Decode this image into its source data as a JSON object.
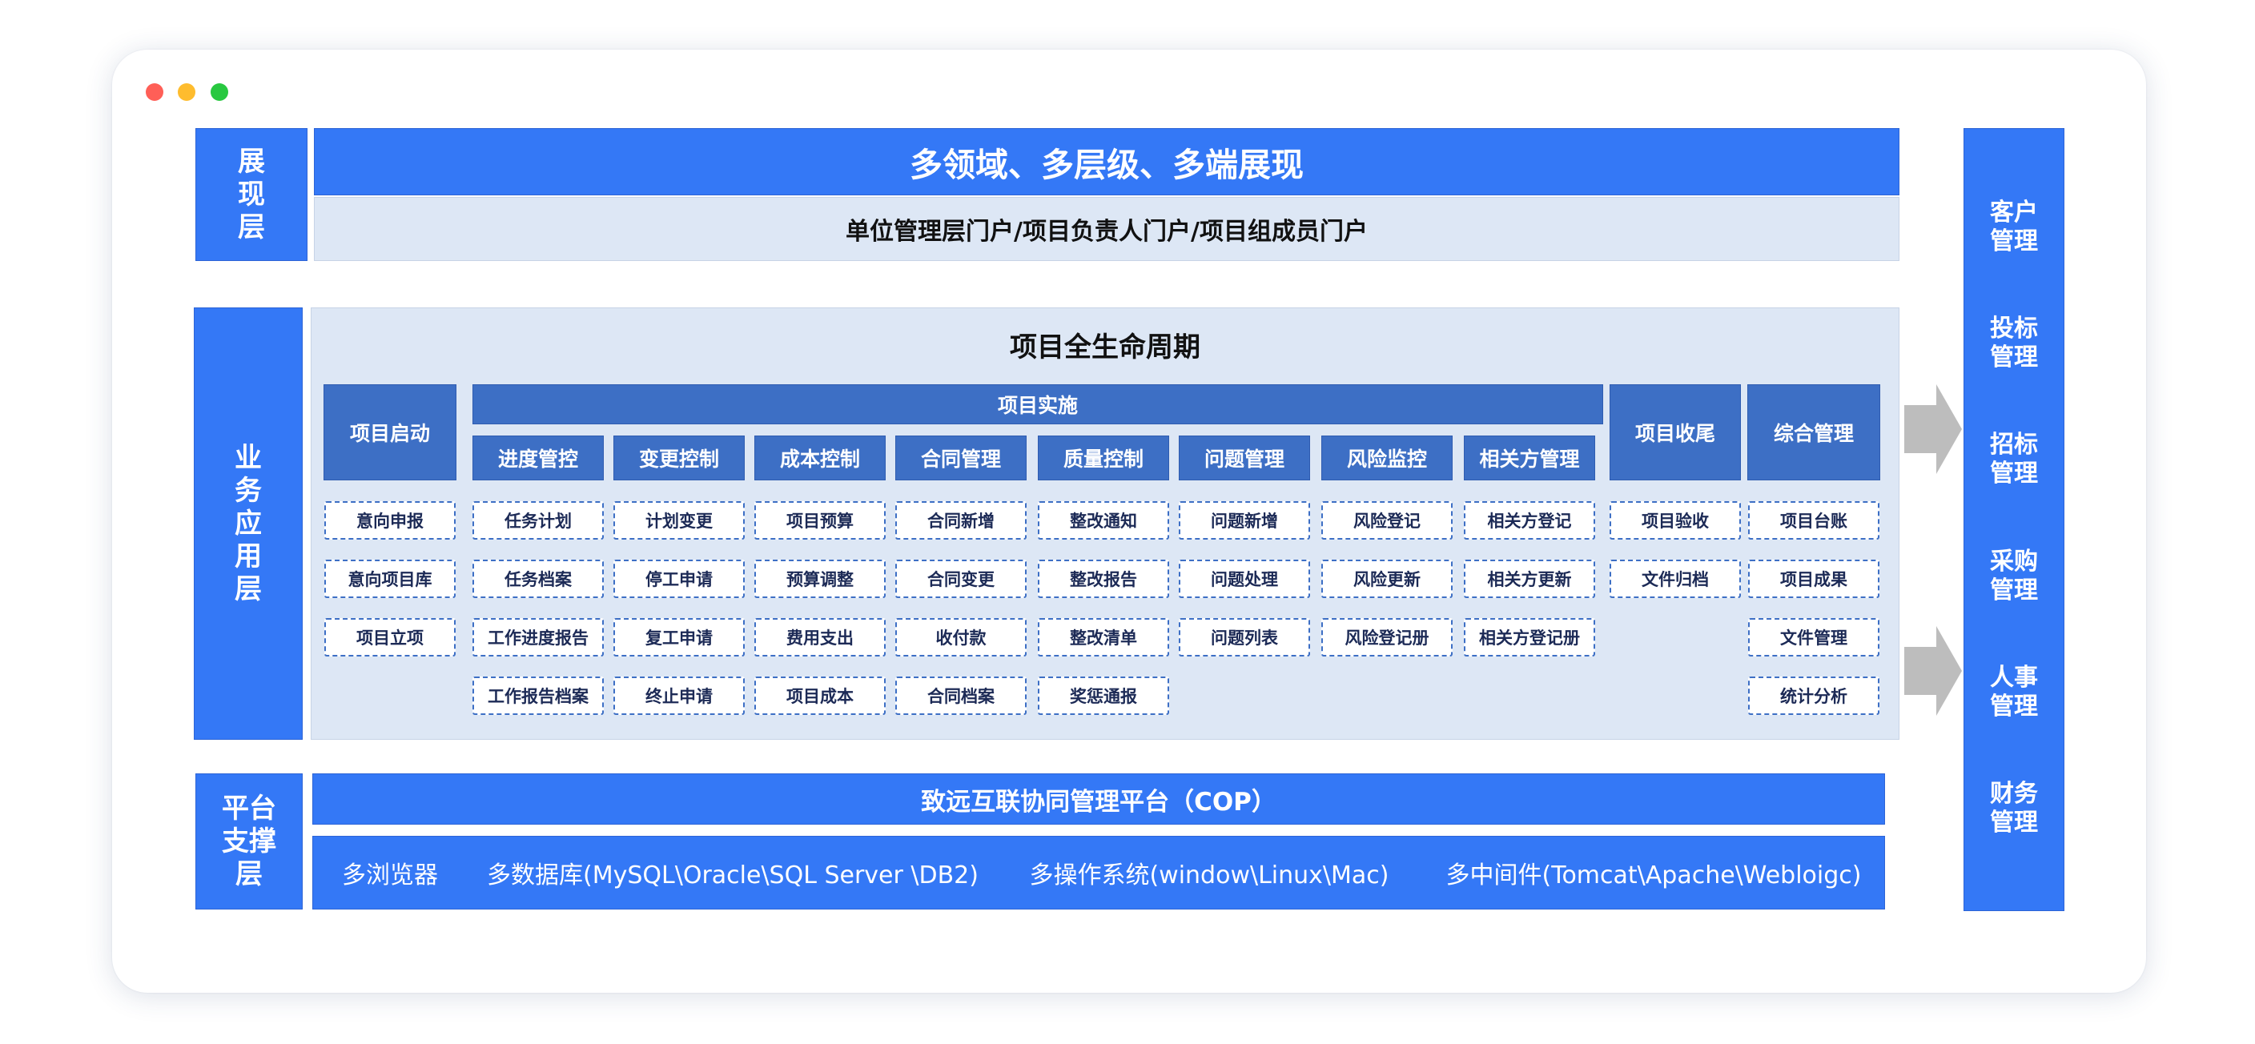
{
  "layers": {
    "presentation": "展现层",
    "business": "业务应用层",
    "platform": "平台支撑层"
  },
  "presentation": {
    "title": "多领域、多层级、多端展现",
    "subtitle": "单位管理层门户/项目负责人门户/项目组成员门户"
  },
  "business": {
    "title": "项目全生命周期",
    "implementation": "项目实施",
    "columns": [
      {
        "header": "项目启动",
        "items": [
          "意向申报",
          "意向项目库",
          "项目立项"
        ]
      },
      {
        "header": "进度管控",
        "items": [
          "任务计划",
          "任务档案",
          "工作进度报告",
          "工作报告档案"
        ]
      },
      {
        "header": "变更控制",
        "items": [
          "计划变更",
          "停工申请",
          "复工申请",
          "终止申请"
        ]
      },
      {
        "header": "成本控制",
        "items": [
          "项目预算",
          "预算调整",
          "费用支出",
          "项目成本"
        ]
      },
      {
        "header": "合同管理",
        "items": [
          "合同新增",
          "合同变更",
          "收付款",
          "合同档案"
        ]
      },
      {
        "header": "质量控制",
        "items": [
          "整改通知",
          "整改报告",
          "整改清单",
          "奖惩通报"
        ]
      },
      {
        "header": "问题管理",
        "items": [
          "问题新增",
          "问题处理",
          "问题列表"
        ]
      },
      {
        "header": "风险监控",
        "items": [
          "风险登记",
          "风险更新",
          "风险登记册"
        ]
      },
      {
        "header": "相关方管理",
        "items": [
          "相关方登记",
          "相关方更新",
          "相关方登记册"
        ]
      },
      {
        "header": "项目收尾",
        "items": [
          "项目验收",
          "文件归档"
        ]
      },
      {
        "header": "综合管理",
        "items": [
          "项目台账",
          "项目成果",
          "文件管理",
          "统计分析"
        ]
      }
    ]
  },
  "right_modules": [
    "客户管理",
    "投标管理",
    "招标管理",
    "采购管理",
    "人事管理",
    "财务管理"
  ],
  "platform": {
    "title": "致远互联协同管理平台（COP）",
    "tech": [
      "多浏览器",
      "多数据库(MySQL\\Oracle\\SQL Server \\DB2)",
      "多操作系统(window\\Linux\\Mac)",
      "多中间件(Tomcat\\Apache\\Webloigc)"
    ]
  },
  "colors": {
    "primary": "#3478f6",
    "header_blue": "#3d6fc5",
    "panel": "#dde7f5",
    "arrow": "#bdbdbd"
  }
}
